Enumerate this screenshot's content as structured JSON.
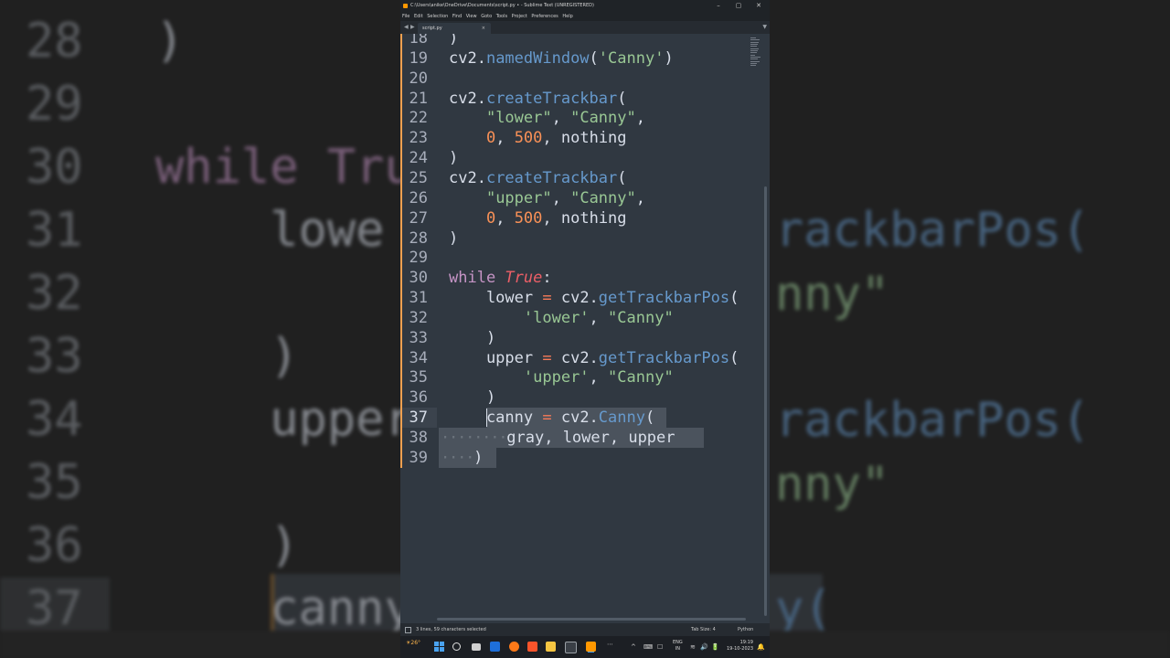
{
  "window": {
    "title": "C:\\Users\\anike\\OneDrive\\Documents\\script.py • - Sublime Text (UNREGISTERED)",
    "menu": [
      "File",
      "Edit",
      "Selection",
      "Find",
      "View",
      "Goto",
      "Tools",
      "Project",
      "Preferences",
      "Help"
    ],
    "controls": {
      "minimize": "–",
      "maximize": "▢",
      "close": "✕"
    }
  },
  "tab": {
    "label": "script.py",
    "close": "×"
  },
  "editor": {
    "lines": [
      {
        "num": "18",
        "tokens": [
          {
            "t": ")",
            "c": "pl"
          }
        ]
      },
      {
        "num": "19",
        "tokens": [
          {
            "t": "cv2.",
            "c": "pl"
          },
          {
            "t": "namedWindow",
            "c": "fn"
          },
          {
            "t": "(",
            "c": "pl"
          },
          {
            "t": "'Canny'",
            "c": "str"
          },
          {
            "t": ")",
            "c": "pl"
          }
        ]
      },
      {
        "num": "20",
        "tokens": []
      },
      {
        "num": "21",
        "tokens": [
          {
            "t": "cv2.",
            "c": "pl"
          },
          {
            "t": "createTrackbar",
            "c": "fn"
          },
          {
            "t": "(",
            "c": "pl"
          }
        ]
      },
      {
        "num": "22",
        "tokens": [
          {
            "t": "    ",
            "c": "pl"
          },
          {
            "t": "\"lower\"",
            "c": "str"
          },
          {
            "t": ", ",
            "c": "pl"
          },
          {
            "t": "\"Canny\"",
            "c": "str"
          },
          {
            "t": ",",
            "c": "pl"
          }
        ]
      },
      {
        "num": "23",
        "tokens": [
          {
            "t": "    ",
            "c": "pl"
          },
          {
            "t": "0",
            "c": "num"
          },
          {
            "t": ", ",
            "c": "pl"
          },
          {
            "t": "500",
            "c": "num"
          },
          {
            "t": ", nothing",
            "c": "pl"
          }
        ]
      },
      {
        "num": "24",
        "tokens": [
          {
            "t": ")",
            "c": "pl"
          }
        ]
      },
      {
        "num": "25",
        "tokens": [
          {
            "t": "cv2.",
            "c": "pl"
          },
          {
            "t": "createTrackbar",
            "c": "fn"
          },
          {
            "t": "(",
            "c": "pl"
          }
        ]
      },
      {
        "num": "26",
        "tokens": [
          {
            "t": "    ",
            "c": "pl"
          },
          {
            "t": "\"upper\"",
            "c": "str"
          },
          {
            "t": ", ",
            "c": "pl"
          },
          {
            "t": "\"Canny\"",
            "c": "str"
          },
          {
            "t": ",",
            "c": "pl"
          }
        ]
      },
      {
        "num": "27",
        "tokens": [
          {
            "t": "    ",
            "c": "pl"
          },
          {
            "t": "0",
            "c": "num"
          },
          {
            "t": ", ",
            "c": "pl"
          },
          {
            "t": "500",
            "c": "num"
          },
          {
            "t": ", nothing",
            "c": "pl"
          }
        ]
      },
      {
        "num": "28",
        "tokens": [
          {
            "t": ")",
            "c": "pl"
          }
        ]
      },
      {
        "num": "29",
        "tokens": []
      },
      {
        "num": "30",
        "tokens": [
          {
            "t": "while ",
            "c": "kw"
          },
          {
            "t": "True",
            "c": "it"
          },
          {
            "t": ":",
            "c": "pl"
          }
        ]
      },
      {
        "num": "31",
        "tokens": [
          {
            "t": "    lower ",
            "c": "pl"
          },
          {
            "t": "=",
            "c": "op"
          },
          {
            "t": " cv2.",
            "c": "pl"
          },
          {
            "t": "getTrackbarPos",
            "c": "fn"
          },
          {
            "t": "(",
            "c": "pl"
          }
        ]
      },
      {
        "num": "32",
        "tokens": [
          {
            "t": "        ",
            "c": "pl"
          },
          {
            "t": "'lower'",
            "c": "str"
          },
          {
            "t": ", ",
            "c": "pl"
          },
          {
            "t": "\"Canny\"",
            "c": "str"
          }
        ]
      },
      {
        "num": "33",
        "tokens": [
          {
            "t": "    )",
            "c": "pl"
          }
        ]
      },
      {
        "num": "34",
        "tokens": [
          {
            "t": "    upper ",
            "c": "pl"
          },
          {
            "t": "=",
            "c": "op"
          },
          {
            "t": " cv2.",
            "c": "pl"
          },
          {
            "t": "getTrackbarPos",
            "c": "fn"
          },
          {
            "t": "(",
            "c": "pl"
          }
        ]
      },
      {
        "num": "35",
        "tokens": [
          {
            "t": "        ",
            "c": "pl"
          },
          {
            "t": "'upper'",
            "c": "str"
          },
          {
            "t": ", ",
            "c": "pl"
          },
          {
            "t": "\"Canny\"",
            "c": "str"
          }
        ]
      },
      {
        "num": "36",
        "tokens": [
          {
            "t": "    )",
            "c": "pl"
          }
        ]
      },
      {
        "num": "37",
        "tokens": [
          {
            "t": "    canny ",
            "c": "pl"
          },
          {
            "t": "=",
            "c": "op"
          },
          {
            "t": " cv2.",
            "c": "pl"
          },
          {
            "t": "Canny",
            "c": "fn"
          },
          {
            "t": "(",
            "c": "pl"
          }
        ]
      },
      {
        "num": "38",
        "tokens": [
          {
            "t": "········",
            "c": "dots"
          },
          {
            "t": "gray, lower, upper",
            "c": "pl"
          }
        ]
      },
      {
        "num": "39",
        "tokens": [
          {
            "t": "····",
            "c": "dots"
          },
          {
            "t": ")",
            "c": "pl"
          }
        ]
      }
    ]
  },
  "status": {
    "selection": "3 lines, 59 characters selected",
    "tab_size": "Tab Size: 4",
    "syntax": "Python"
  },
  "taskbar": {
    "weather": "26°",
    "language": [
      "ENG",
      "IN"
    ],
    "time": "19:19",
    "date": "19-10-2023",
    "tray": [
      "^",
      "⌨",
      "☐",
      "🔊",
      "🔋"
    ]
  },
  "background": {
    "lines": [
      {
        "num": "28",
        "code": ")"
      },
      {
        "num": "29",
        "code": ""
      },
      {
        "num": "30",
        "code": "while Tru"
      },
      {
        "num": "31",
        "code": "    lowe"
      },
      {
        "num": "32",
        "code": ""
      },
      {
        "num": "33",
        "code": "    )"
      },
      {
        "num": "34",
        "code": "    upper"
      },
      {
        "num": "35",
        "code": ""
      },
      {
        "num": "36",
        "code": "    )"
      },
      {
        "num": "37",
        "code": "    canny"
      }
    ],
    "right": [
      {
        "text": "rackbarPos("
      },
      {
        "text": "nny\""
      },
      {
        "text": "rackbarPos("
      },
      {
        "text": "nny\""
      },
      {
        "text": "y("
      }
    ]
  },
  "colors": {
    "editor_bg": "#303841",
    "gutter_marker": "#f0a050",
    "string": "#99c794",
    "function": "#6699cc",
    "number": "#f99157",
    "keyword": "#c594c5"
  }
}
